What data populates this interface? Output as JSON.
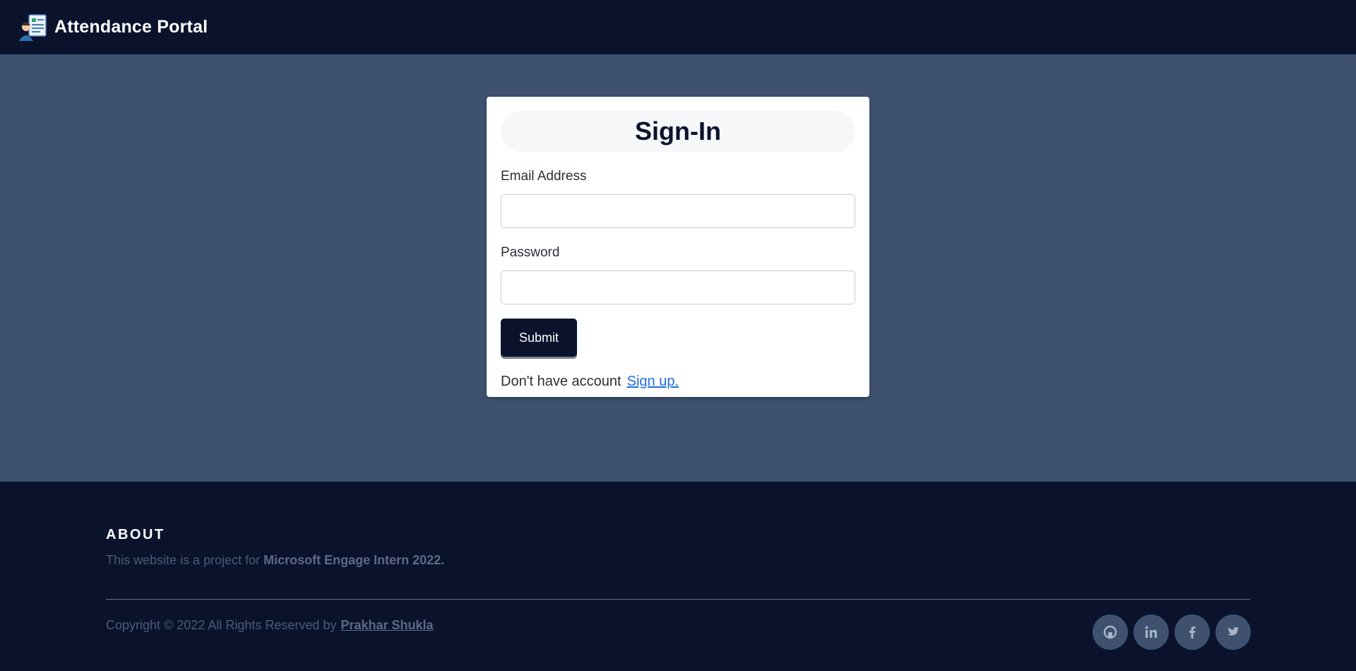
{
  "navbar": {
    "brand": "Attendance Portal",
    "logo_icon": "attendance-logo-icon"
  },
  "signin": {
    "title": "Sign-In",
    "email_label": "Email Address",
    "email_value": "",
    "password_label": "Password",
    "password_value": "",
    "submit_label": "Submit",
    "no_account_text": "Don't have account",
    "signup_link": "Sign up."
  },
  "footer": {
    "about_heading": "ABOUT",
    "about_text": "This website is a project for",
    "about_strong": "Microsoft Engage Intern 2022.",
    "copyright": "Copyright © 2022 All Rights Reserved by",
    "author": "Prakhar Shukla",
    "socials": [
      "github-icon",
      "linkedin-icon",
      "facebook-icon",
      "twitter-icon"
    ]
  },
  "colors": {
    "navbar_bg": "#0b132c",
    "page_bg": "#3e5270",
    "card_bg": "#ffffff",
    "button_bg": "#0b132c",
    "link": "#1f6fe0"
  }
}
